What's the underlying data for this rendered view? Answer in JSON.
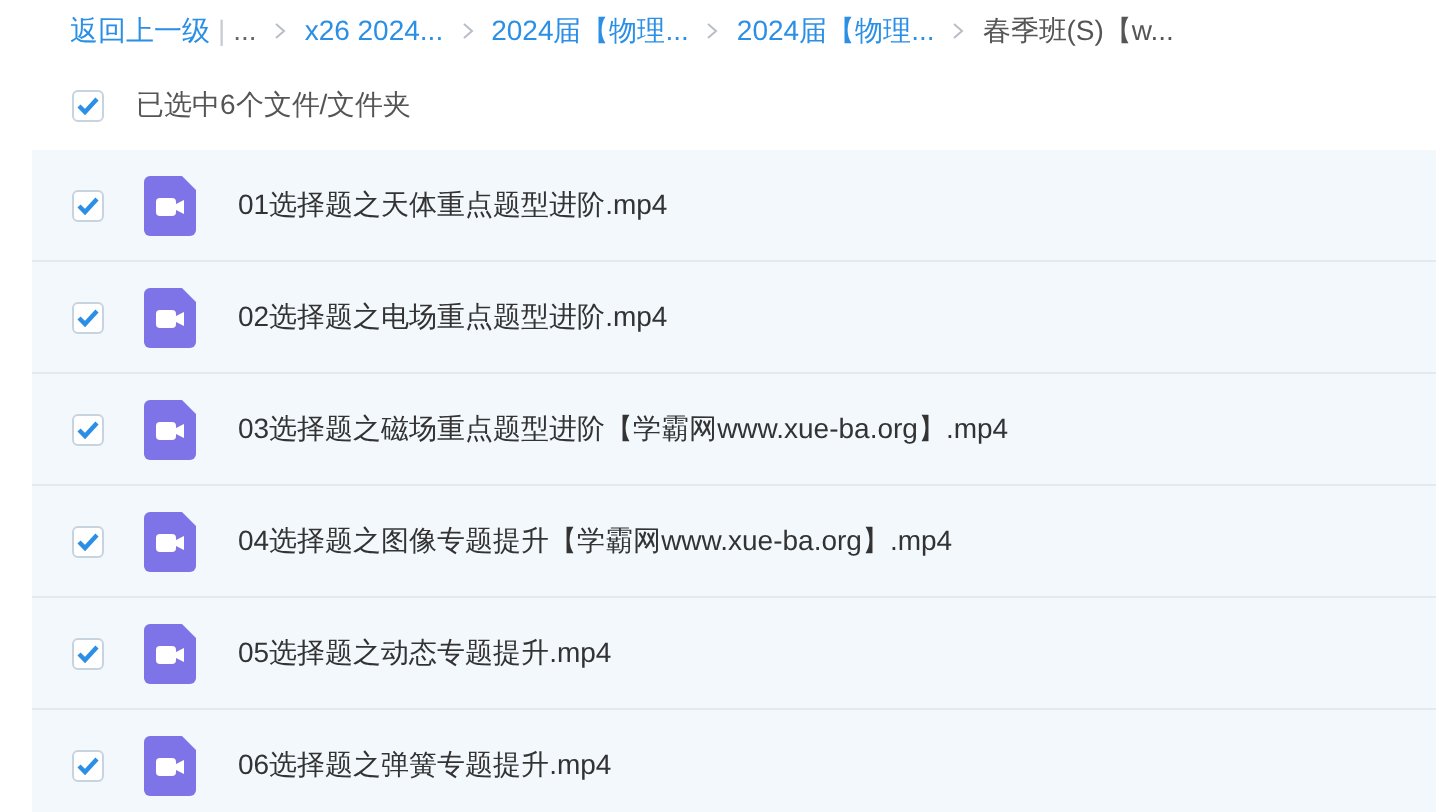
{
  "breadcrumb": {
    "back": "返回上一级",
    "separator": "|",
    "items": [
      {
        "label": "..."
      },
      {
        "label": "x26 2024..."
      },
      {
        "label": "2024届【物理..."
      },
      {
        "label": "2024届【物理..."
      },
      {
        "label": "春季班(S)【w...",
        "current": true
      }
    ]
  },
  "selection": {
    "checked": true,
    "label": "已选中6个文件/文件夹"
  },
  "files": [
    {
      "name": "01选择题之天体重点题型进阶.mp4",
      "checked": true
    },
    {
      "name": "02选择题之电场重点题型进阶.mp4",
      "checked": true
    },
    {
      "name": "03选择题之磁场重点题型进阶【学霸网www.xue-ba.org】.mp4",
      "checked": true
    },
    {
      "name": "04选择题之图像专题提升【学霸网www.xue-ba.org】.mp4",
      "checked": true
    },
    {
      "name": "05选择题之动态专题提升.mp4",
      "checked": true
    },
    {
      "name": "06选择题之弹簧专题提升.mp4",
      "checked": true
    }
  ]
}
